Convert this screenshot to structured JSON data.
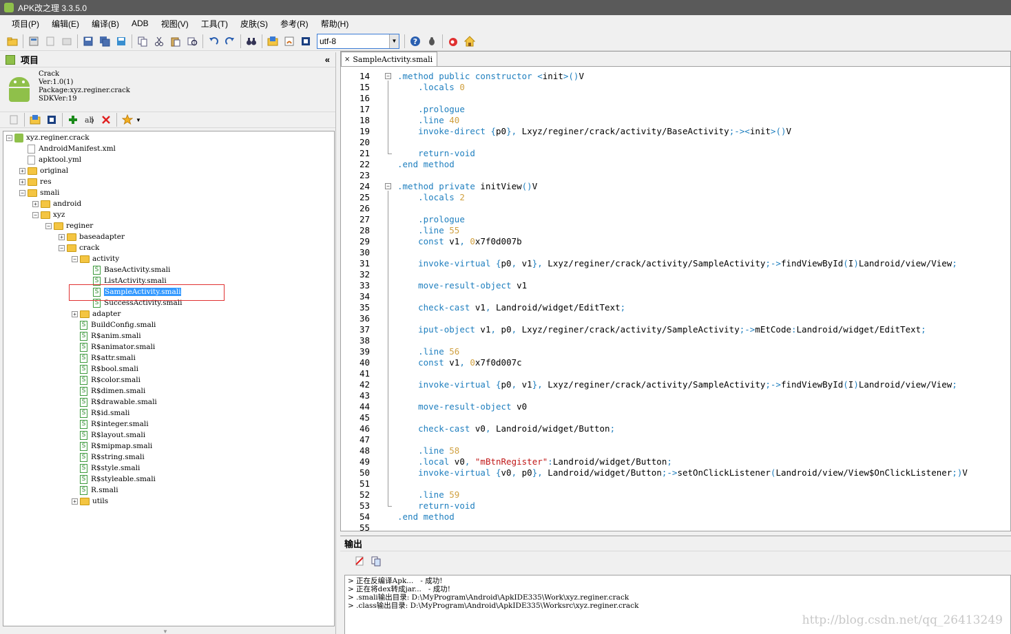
{
  "window": {
    "title": "APK改之理 3.3.5.0"
  },
  "menu": [
    "项目(P)",
    "编辑(E)",
    "编译(B)",
    "ADB",
    "视图(V)",
    "工具(T)",
    "皮肤(S)",
    "参考(R)",
    "帮助(H)"
  ],
  "toolbar": {
    "encoding": "utf-8"
  },
  "project_panel": {
    "title": "项目",
    "collapse_glyph": "«",
    "info": [
      "Crack",
      "Ver:1.0(1)",
      "Package:xyz.reginer.crack",
      "SDKVer:19"
    ]
  },
  "tree": [
    {
      "label": "xyz.reginer.crack",
      "depth": 0,
      "type": "apk",
      "exp": "−"
    },
    {
      "label": "AndroidManifest.xml",
      "depth": 1,
      "type": "file",
      "exp": ""
    },
    {
      "label": "apktool.yml",
      "depth": 1,
      "type": "file",
      "exp": ""
    },
    {
      "label": "original",
      "depth": 1,
      "type": "folder",
      "exp": "+"
    },
    {
      "label": "res",
      "depth": 1,
      "type": "folder",
      "exp": "+"
    },
    {
      "label": "smali",
      "depth": 1,
      "type": "folder",
      "exp": "−"
    },
    {
      "label": "android",
      "depth": 2,
      "type": "folder",
      "exp": "+"
    },
    {
      "label": "xyz",
      "depth": 2,
      "type": "folder",
      "exp": "−"
    },
    {
      "label": "reginer",
      "depth": 3,
      "type": "folder",
      "exp": "−"
    },
    {
      "label": "baseadapter",
      "depth": 4,
      "type": "folder",
      "exp": "+"
    },
    {
      "label": "crack",
      "depth": 4,
      "type": "folder",
      "exp": "−"
    },
    {
      "label": "activity",
      "depth": 5,
      "type": "folder",
      "exp": "−"
    },
    {
      "label": "BaseActivity.smali",
      "depth": 6,
      "type": "smali",
      "exp": ""
    },
    {
      "label": "ListActivity.smali",
      "depth": 6,
      "type": "smali",
      "exp": ""
    },
    {
      "label": "SampleActivity.smali",
      "depth": 6,
      "type": "smali",
      "exp": "",
      "selected": true
    },
    {
      "label": "SuccessActivity.smali",
      "depth": 6,
      "type": "smali",
      "exp": ""
    },
    {
      "label": "adapter",
      "depth": 5,
      "type": "folder",
      "exp": "+"
    },
    {
      "label": "BuildConfig.smali",
      "depth": 5,
      "type": "smali",
      "exp": ""
    },
    {
      "label": "R$anim.smali",
      "depth": 5,
      "type": "smali",
      "exp": ""
    },
    {
      "label": "R$animator.smali",
      "depth": 5,
      "type": "smali",
      "exp": ""
    },
    {
      "label": "R$attr.smali",
      "depth": 5,
      "type": "smali",
      "exp": ""
    },
    {
      "label": "R$bool.smali",
      "depth": 5,
      "type": "smali",
      "exp": ""
    },
    {
      "label": "R$color.smali",
      "depth": 5,
      "type": "smali",
      "exp": ""
    },
    {
      "label": "R$dimen.smali",
      "depth": 5,
      "type": "smali",
      "exp": ""
    },
    {
      "label": "R$drawable.smali",
      "depth": 5,
      "type": "smali",
      "exp": ""
    },
    {
      "label": "R$id.smali",
      "depth": 5,
      "type": "smali",
      "exp": ""
    },
    {
      "label": "R$integer.smali",
      "depth": 5,
      "type": "smali",
      "exp": ""
    },
    {
      "label": "R$layout.smali",
      "depth": 5,
      "type": "smali",
      "exp": ""
    },
    {
      "label": "R$mipmap.smali",
      "depth": 5,
      "type": "smali",
      "exp": ""
    },
    {
      "label": "R$string.smali",
      "depth": 5,
      "type": "smali",
      "exp": ""
    },
    {
      "label": "R$style.smali",
      "depth": 5,
      "type": "smali",
      "exp": ""
    },
    {
      "label": "R$styleable.smali",
      "depth": 5,
      "type": "smali",
      "exp": ""
    },
    {
      "label": "R.smali",
      "depth": 5,
      "type": "smali",
      "exp": ""
    },
    {
      "label": "utils",
      "depth": 5,
      "type": "folder",
      "exp": "+"
    }
  ],
  "editor": {
    "tab_label": "SampleActivity.smali",
    "lines": [
      {
        "n": "14",
        "t": ".method public constructor <init>()V",
        "fold": "start"
      },
      {
        "n": "15",
        "t": "    .locals 0"
      },
      {
        "n": "16",
        "t": ""
      },
      {
        "n": "17",
        "t": "    .prologue"
      },
      {
        "n": "18",
        "t": "    .line 40"
      },
      {
        "n": "19",
        "t": "    invoke-direct {p0}, Lxyz/reginer/crack/activity/BaseActivity;-><init>()V"
      },
      {
        "n": "20",
        "t": ""
      },
      {
        "n": "21",
        "t": "    return-void",
        "fold": "end"
      },
      {
        "n": "22",
        "t": ".end method"
      },
      {
        "n": "23",
        "t": ""
      },
      {
        "n": "24",
        "t": ".method private initView()V",
        "fold": "start"
      },
      {
        "n": "25",
        "t": "    .locals 2"
      },
      {
        "n": "26",
        "t": ""
      },
      {
        "n": "27",
        "t": "    .prologue"
      },
      {
        "n": "28",
        "t": "    .line 55"
      },
      {
        "n": "29",
        "t": "    const v1, 0x7f0d007b"
      },
      {
        "n": "30",
        "t": ""
      },
      {
        "n": "31",
        "t": "    invoke-virtual {p0, v1}, Lxyz/reginer/crack/activity/SampleActivity;->findViewById(I)Landroid/view/View;"
      },
      {
        "n": "32",
        "t": ""
      },
      {
        "n": "33",
        "t": "    move-result-object v1"
      },
      {
        "n": "34",
        "t": ""
      },
      {
        "n": "35",
        "t": "    check-cast v1, Landroid/widget/EditText;"
      },
      {
        "n": "36",
        "t": ""
      },
      {
        "n": "37",
        "t": "    iput-object v1, p0, Lxyz/reginer/crack/activity/SampleActivity;->mEtCode:Landroid/widget/EditText;"
      },
      {
        "n": "38",
        "t": ""
      },
      {
        "n": "39",
        "t": "    .line 56"
      },
      {
        "n": "40",
        "t": "    const v1, 0x7f0d007c"
      },
      {
        "n": "41",
        "t": ""
      },
      {
        "n": "42",
        "t": "    invoke-virtual {p0, v1}, Lxyz/reginer/crack/activity/SampleActivity;->findViewById(I)Landroid/view/View;"
      },
      {
        "n": "43",
        "t": ""
      },
      {
        "n": "44",
        "t": "    move-result-object v0"
      },
      {
        "n": "45",
        "t": ""
      },
      {
        "n": "46",
        "t": "    check-cast v0, Landroid/widget/Button;"
      },
      {
        "n": "47",
        "t": ""
      },
      {
        "n": "48",
        "t": "    .line 58"
      },
      {
        "n": "49",
        "t": "    .local v0, \"mBtnRegister\":Landroid/widget/Button;"
      },
      {
        "n": "50",
        "t": "    invoke-virtual {v0, p0}, Landroid/widget/Button;->setOnClickListener(Landroid/view/View$OnClickListener;)V"
      },
      {
        "n": "51",
        "t": ""
      },
      {
        "n": "52",
        "t": "    .line 59"
      },
      {
        "n": "53",
        "t": "    return-void",
        "fold": "end"
      },
      {
        "n": "54",
        "t": ".end method"
      },
      {
        "n": "55",
        "t": ""
      }
    ]
  },
  "output": {
    "title": "输出",
    "lines": [
      "> 正在反编译Apk...   - 成功!",
      "> 正在将dex转成jar...   - 成功!",
      "> .smali输出目录: D:\\MyProgram\\Android\\ApkIDE335\\Work\\xyz.reginer.crack",
      "> .class输出目录: D:\\MyProgram\\Android\\ApkIDE335\\Worksrc\\xyz.reginer.crack"
    ]
  },
  "watermark": "http://blog.csdn.net/qq_26413249"
}
